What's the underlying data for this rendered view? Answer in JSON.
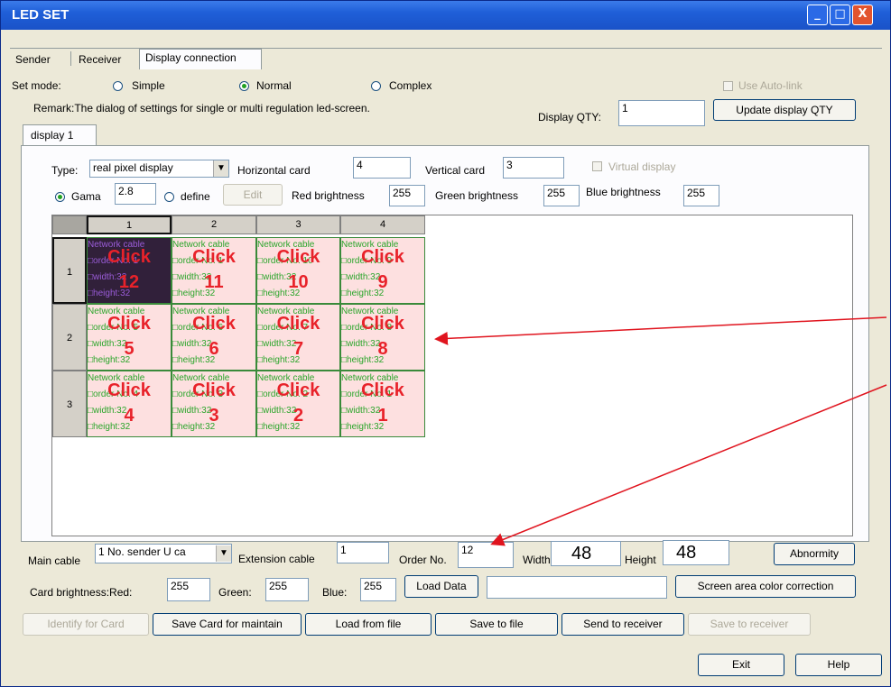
{
  "window": {
    "title": "LED SET",
    "buttons": {
      "minimize": "_",
      "maximize": "□",
      "close": "X"
    }
  },
  "tabs": [
    "Sender",
    "Receiver",
    "Display connection"
  ],
  "set_mode": {
    "label": "Set mode:",
    "options": [
      "Simple",
      "Normal",
      "Complex"
    ],
    "selected": "Normal"
  },
  "use_auto_link": "Use Auto-link",
  "remark": "Remark:The dialog of settings for single or multi  regulation led-screen.",
  "display_qty": {
    "label": "Display QTY:",
    "value": "1"
  },
  "update_button": "Update display QTY",
  "display_tab": "display 1",
  "type": {
    "label": "Type:",
    "value": "real pixel display"
  },
  "horizontal_card": {
    "label": "Horizontal card",
    "value": "4"
  },
  "vertical_card": {
    "label": "Vertical card",
    "value": "3"
  },
  "virtual_display": "Virtual display",
  "gama": {
    "label": "Gama",
    "value": "2.8",
    "define_label": "define",
    "edit_button": "Edit"
  },
  "brightness": {
    "red_label": "Red brightness",
    "red": "255",
    "green_label": "Green brightness",
    "green": "255",
    "blue_label": "Blue brightness",
    "blue": "255"
  },
  "grid": {
    "col_headers": [
      "1",
      "2",
      "3",
      "4"
    ],
    "row_headers": [
      "1",
      "2",
      "3"
    ],
    "cells": [
      [
        {
          "line1": "Network cable",
          "line2": "□order No. 1",
          "line3": "□width:32",
          "line4": "□height:32",
          "click": "Click",
          "num": "12",
          "selected": true
        },
        {
          "line1": "Network cable",
          "line2": "□order No. 1",
          "line3": "□width:32",
          "line4": "□height:32",
          "click": "Click",
          "num": "11"
        },
        {
          "line1": "Network cable",
          "line2": "□order No. 10",
          "line3": "□width:32",
          "line4": "□height:32",
          "click": "Click",
          "num": "10"
        },
        {
          "line1": "Network cable",
          "line2": "□order No. 9",
          "line3": "□width:32",
          "line4": "□height:32",
          "click": "Click",
          "num": "9"
        }
      ],
      [
        {
          "line1": "Network cable",
          "line2": "□order No. 5",
          "line3": "□width:32",
          "line4": "□height:32",
          "click": "Click",
          "num": "5"
        },
        {
          "line1": "Network cable",
          "line2": "□order No. 6",
          "line3": "□width:32",
          "line4": "□height:32",
          "click": "Click",
          "num": "6"
        },
        {
          "line1": "Network cable",
          "line2": "□order No. 7",
          "line3": "□width:32",
          "line4": "□height:32",
          "click": "Click",
          "num": "7"
        },
        {
          "line1": "Network cable",
          "line2": "□order No. 8",
          "line3": "□width:32",
          "line4": "□height:32",
          "click": "Click",
          "num": "8"
        }
      ],
      [
        {
          "line1": "Network cable",
          "line2": "□order No. 4",
          "line3": "□width:32",
          "line4": "□height:32",
          "click": "Click",
          "num": "4"
        },
        {
          "line1": "Network cable",
          "line2": "□order No. 3",
          "line3": "□width:32",
          "line4": "□height:32",
          "click": "Click",
          "num": "3"
        },
        {
          "line1": "Network cable",
          "line2": "□order No. 2",
          "line3": "□width:32",
          "line4": "□height:32",
          "click": "Click",
          "num": "2"
        },
        {
          "line1": "Network cable",
          "line2": "□order No. 1",
          "line3": "□width:32",
          "line4": "□height:32",
          "click": "Click",
          "num": "1"
        }
      ]
    ]
  },
  "main_cable": {
    "label": "Main cable",
    "value": "1 No. sender U ca"
  },
  "extension_cable": {
    "label": "Extension cable",
    "value": "1"
  },
  "order_no": {
    "label": "Order No.",
    "value": "12"
  },
  "width": {
    "label": "Width",
    "value": "48"
  },
  "height": {
    "label": "Height",
    "value": "48"
  },
  "abnormity_button": "Abnormity",
  "card_brightness": {
    "label": "Card brightness:Red:",
    "red": "255",
    "green_label": "Green:",
    "green": "255",
    "blue_label": "Blue:",
    "blue": "255"
  },
  "load_data_button": "Load Data",
  "load_data_value": "",
  "color_correction_button": "Screen area color correction",
  "bottom_buttons": [
    "Identify for Card",
    "Save Card for maintain",
    "Load from file",
    "Save to file",
    "Send to receiver",
    "Save to receiver"
  ],
  "exit_button": "Exit",
  "help_button": "Help",
  "colors": {
    "titlebar": "#1f5fd8",
    "window_bg": "#ece9d8",
    "cell_bg": "#fde0e0",
    "cell_text": "#2aa52a",
    "click_text": "#e8222a",
    "arrow": "#e0141e"
  }
}
